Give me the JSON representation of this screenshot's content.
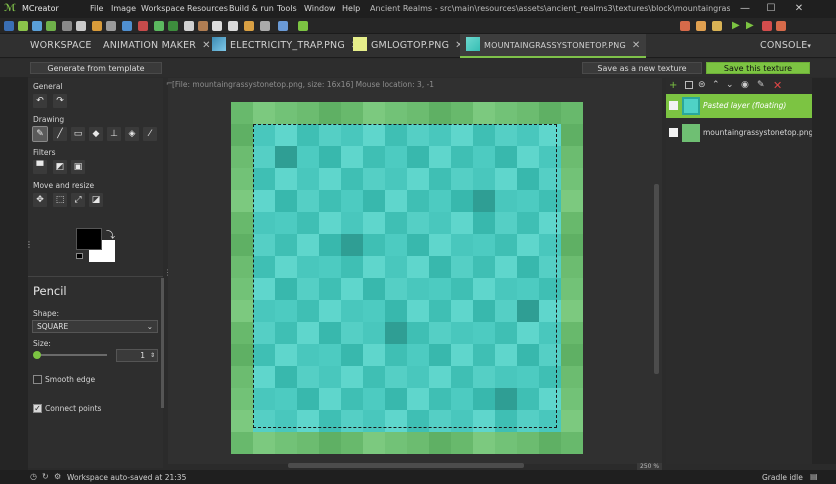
{
  "app": {
    "name": "MCreator",
    "menu": [
      "File",
      "Image",
      "Workspace",
      "Resources",
      "Build & run",
      "Tools",
      "Window",
      "Help"
    ],
    "project_path": "Ancient Realms - src\\main\\resources\\assets\\ancient_realms3\\textures\\block\\mountaingrassystonetop.png - ..."
  },
  "tabs": [
    {
      "label": "WORKSPACE"
    },
    {
      "label": "ANIMATION MAKER"
    },
    {
      "label": "ELECTRICITY_TRAP.PNG"
    },
    {
      "label": "GMLOGTOP.PNG"
    },
    {
      "label": "MOUNTAINGRASSYSTONETOP.PNG"
    }
  ],
  "console_label": "CONSOLE",
  "actions": {
    "generate": "Generate from template",
    "save_as_new": "Save as a new texture",
    "save": "Save this texture"
  },
  "tools": {
    "general": "General",
    "drawing": "Drawing",
    "filters": "Filters",
    "move_resize": "Move and resize"
  },
  "pencil": {
    "title": "Pencil",
    "shape_label": "Shape:",
    "shape_value": "SQUARE",
    "size_label": "Size:",
    "size_value": "1",
    "size_fraction": 0.0,
    "smooth_edge": "Smooth edge",
    "smooth_edge_checked": false,
    "connect_points": "Connect points",
    "connect_points_checked": true
  },
  "canvas": {
    "file_info": "[File: mountaingrassystonetop.png, size: 16x16] Mouse location: 3, -1",
    "zoom": "250 %"
  },
  "layers": [
    {
      "name": "Pasted layer (floating)",
      "selected": true
    },
    {
      "name": "mountaingrassystonetop.png",
      "selected": false
    }
  ],
  "status": {
    "left": "Workspace auto-saved at 21:35",
    "right": "Gradle idle"
  },
  "colors": {
    "accent": "#7cc442",
    "primary_color": "#000000",
    "secondary_color": "#ffffff"
  }
}
